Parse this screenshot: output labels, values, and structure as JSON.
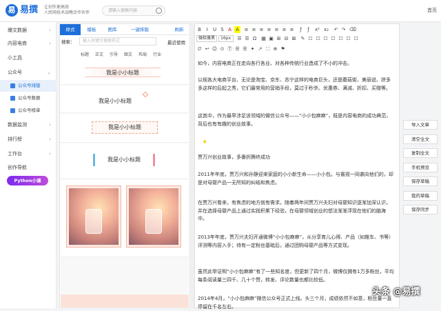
{
  "header": {
    "logo_glyph": "易",
    "brand": "易撰",
    "slogan_line1": "让创作更高效",
    "slogan_line2": "人民网技术战略合作伙伴",
    "search_placeholder": "请输入搜索内容",
    "home": "首页"
  },
  "sidebar": {
    "items": [
      {
        "label": "爆文数据",
        "arrow": "›"
      },
      {
        "label": "内容电商",
        "arrow": "›"
      },
      {
        "label": "小工具",
        "arrow": ""
      },
      {
        "label": "公众号",
        "arrow": "⌄"
      },
      {
        "label": "公众号排版",
        "arrow": ""
      },
      {
        "label": "公众号数据",
        "arrow": ""
      },
      {
        "label": "公众号榜单",
        "arrow": ""
      },
      {
        "label": "数据监测",
        "arrow": "›"
      },
      {
        "label": "排行榜",
        "arrow": "›"
      },
      {
        "label": "工作台",
        "arrow": "›"
      },
      {
        "label": "创作导航",
        "arrow": ""
      }
    ],
    "badge": "Python小课"
  },
  "material": {
    "tabs": [
      "样式",
      "模板",
      "图库",
      "一键排版",
      "刷新"
    ],
    "search_label": "搜索：",
    "search_placeholder": "输入关键字搜索样式",
    "recent": "最近使用",
    "categories": [
      "标题",
      "正文",
      "引导",
      "图文",
      "布局",
      "行业"
    ],
    "titles": [
      "我是小小标题",
      "我是小小标题",
      "我是小小标题",
      "我是小小标题"
    ]
  },
  "toolbar": {
    "row1": [
      "B",
      "I",
      "U",
      "S",
      "A",
      "A",
      "≡",
      "≡",
      "≡",
      "≡",
      "≡",
      "≡",
      "≡",
      "ƒ",
      "ƒ",
      "x²",
      "x₂",
      "↶",
      "↷",
      "⌫"
    ],
    "font": "微软雅黑",
    "size": "16px",
    "row2": [
      "☰",
      "☰",
      "Ω",
      "▦",
      "▣",
      "⊞",
      "⊟",
      "⊠",
      "✎",
      "☐",
      "☐",
      "☐",
      "☐",
      "☐",
      "☐",
      "☐"
    ],
    "row3": [
      "∅",
      "↩",
      "☺",
      "⊙",
      "Ⓣ",
      "☰",
      "☰",
      "✦",
      "↗",
      "⛶",
      "⊕",
      "⚑"
    ]
  },
  "content": {
    "paragraphs": [
      "如今，内容电商正在走向各行各业、对各种传统行业造成了不小的冲击。",
      "以规各大电商平台、无论是淘宝、京东、苏宁这样的电商巨头，还是蘑菇街、美丽说、拼多多这样的后起之秀，它们最常用的营销手段，莫过于秒杀、优惠券、满减、折扣、买赠等。",
      "这其中，作为最早涉足该领域的微信公众号——“小小包麻麻”，既是内容电商的成功典范，背后也有有趣的创业故事。",
      "贾万兴创业故事，多番折腾终成功",
      "2011年年底，贾万兴和孙静迎来家庭的小小新生命——小小包。与寰视一同袭向他们的，却是对母婴产品一无所知的纠结和焦虑。",
      "在贾万兴看来，有焦虑的地方就有需求。随着两年间贾万兴夫妇对母婴知识逐渐加深认识，并在选择母婴产品上通过实践积累下经验，在母婴领域创业的想法渐渐浮现在他们的脑海中。",
      "2013年年底，贾万兴夫妇开通微博“小小包麻麻”，从分享育儿心得、产品（如推车、书等）评测等内容入手；待有一定粉丝基础后，通过团购母婴产品等方式变现。",
      "虽然此举证明“小小包麻麻”有了一些知名度，但更新了四个月，微博仅拥有1万多粉丝，平均每条阅读量三四千、几十个赞，转发、评论数量也都比较低。",
      "2014年4月，“小小包麻麻”微信公众号正式上线。头三个月，成绩依然不如意，粉丝量一直停留在千名左右。"
    ]
  },
  "right_buttons": [
    "导入文章",
    "清空全文",
    "复制全文",
    "手机预览",
    "保存草稿",
    "我的草稿",
    "保存同步"
  ],
  "watermark": "头条 @易撰"
}
